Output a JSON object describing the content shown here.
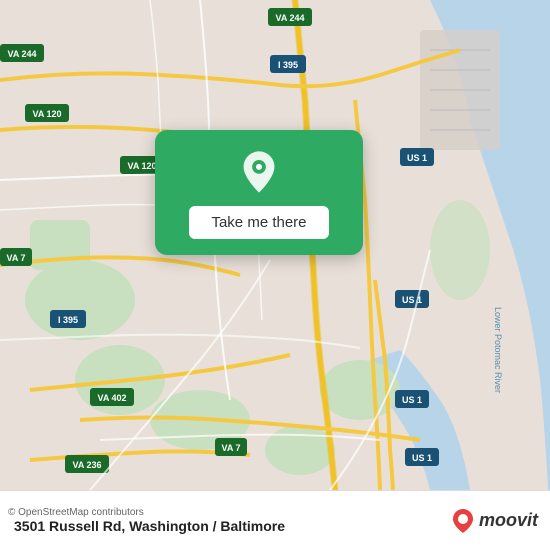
{
  "map": {
    "alt": "Street map of Washington/Baltimore area",
    "attribution": "© OpenStreetMap contributors",
    "center_lat": 38.82,
    "center_lon": -77.07
  },
  "popup": {
    "pin_icon": "location-pin",
    "button_label": "Take me there"
  },
  "bottom_bar": {
    "address": "3501 Russell Rd, Washington / Baltimore",
    "attribution": "© OpenStreetMap contributors",
    "logo_text": "moovit"
  },
  "colors": {
    "green": "#2eaa62",
    "map_bg": "#e8e0d8",
    "water": "#b8d4e8",
    "road_major": "#f5c842",
    "road_minor": "#ffffff",
    "green_area": "#c8dfc0"
  }
}
